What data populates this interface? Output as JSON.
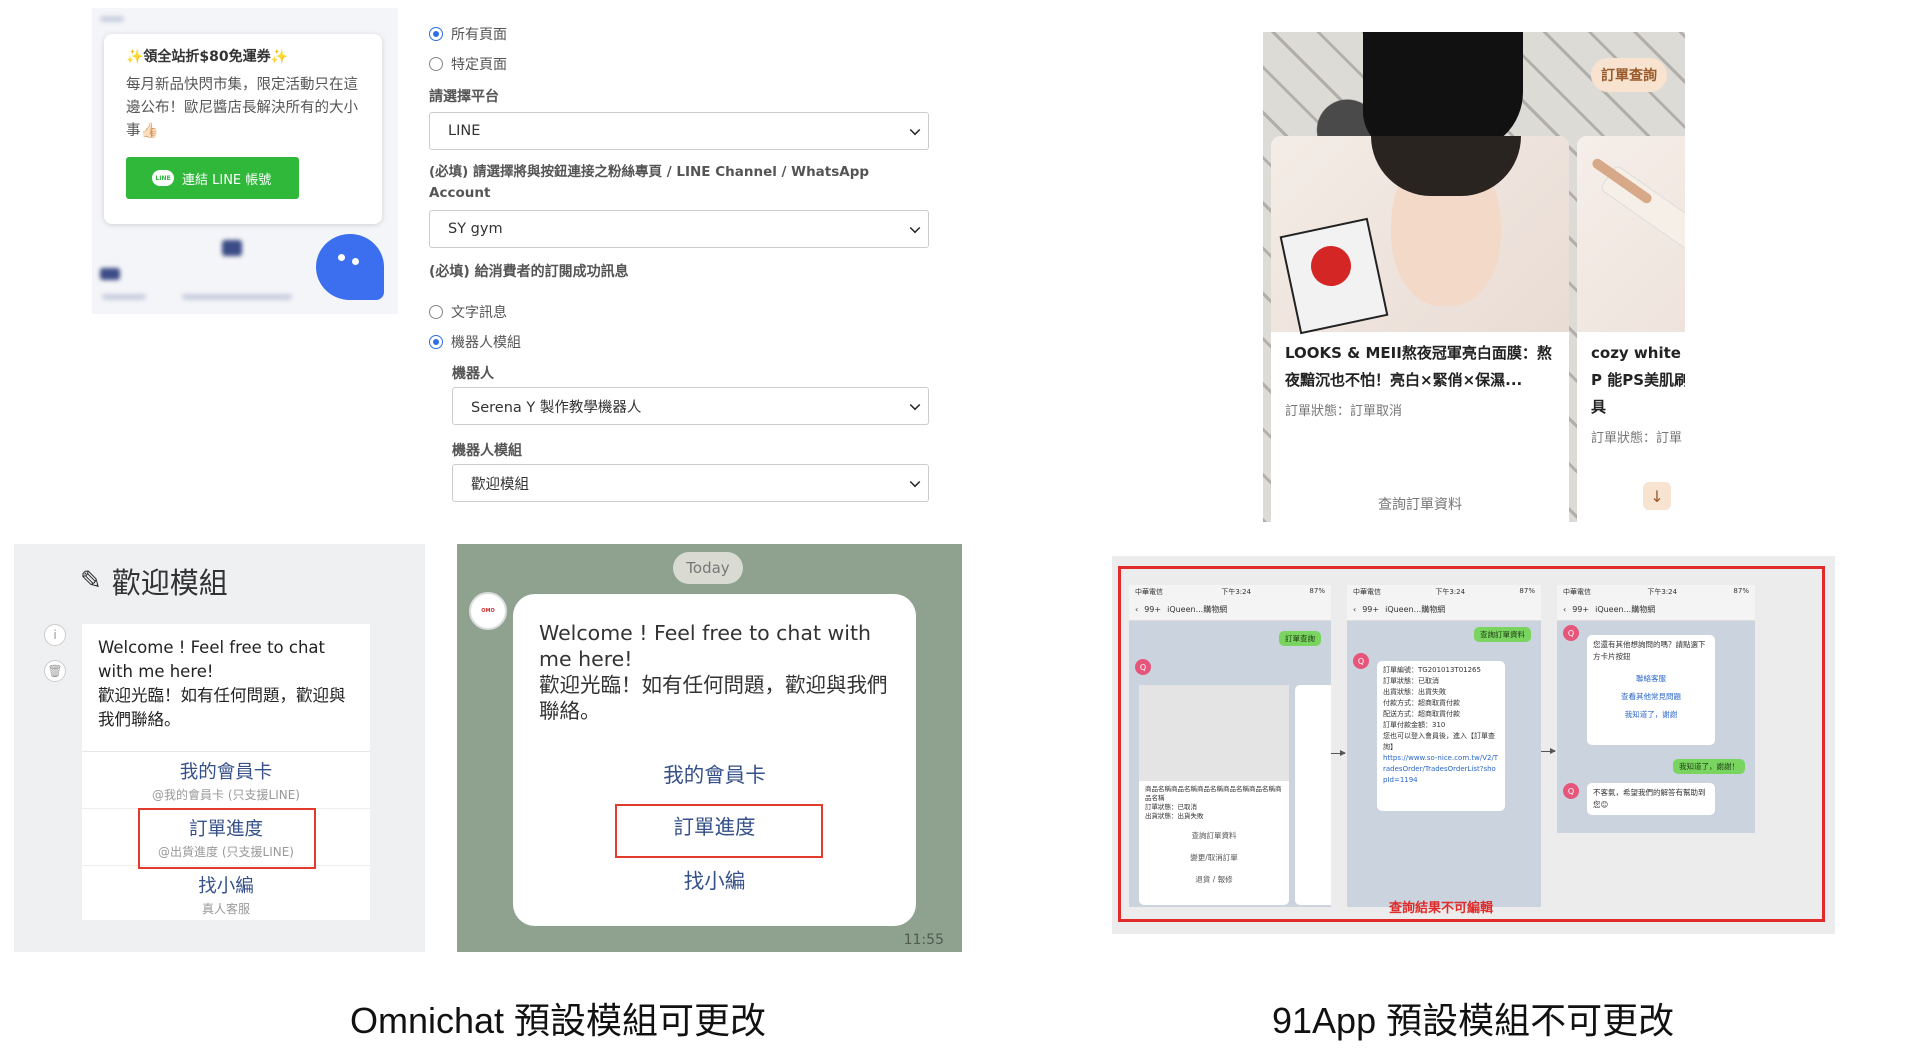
{
  "widget_preview": {
    "promo": "✨領全站折$80免運券✨",
    "description": "每月新品快閃市集，限定活動只在這邊公布！歐尼醬店長解決所有的大小事👍🏻",
    "line_button_icon": "LINE",
    "line_button": "連結 LINE 帳號"
  },
  "settings_form": {
    "radios_page": [
      {
        "label": "所有頁面",
        "selected": true
      },
      {
        "label": "特定頁面",
        "selected": false
      }
    ],
    "platform_label": "請選擇平台",
    "platform_value": "LINE",
    "channel_label": "(必填) 請選擇將與按鈕連接之粉絲專頁 / LINE Channel / WhatsApp Account",
    "channel_value": "SY gym",
    "success_label": "(必填) 給消費者的訂閱成功訊息",
    "radios_message": [
      {
        "label": "文字訊息",
        "selected": false
      },
      {
        "label": "機器人模組",
        "selected": true
      }
    ],
    "bot_label": "機器人",
    "bot_value": "Serena Y 製作教學機器人",
    "module_label": "機器人模組",
    "module_value": "歡迎模組"
  },
  "app91_cards": {
    "order_pill": "訂單查詢",
    "card1": {
      "title": "LOOKS & MEII熬夜冠軍亮白面膜：熬夜黯沉也不怕！亮白×緊俏×保濕...",
      "status": "訂單狀態：訂單取消",
      "query": "查詢訂單資料"
    },
    "card2": {
      "title": "cozy white P 能PS美肌刷具",
      "status": "訂單狀態：訂單"
    }
  },
  "editor": {
    "title": "歡迎模組",
    "message": "Welcome ! Feel free to chat with me here!\n歡迎光臨！如有任何問題，歡迎與我們聯絡。",
    "buttons": [
      {
        "label": "我的會員卡",
        "sub": "@我的會員卡 (只支援LINE)"
      },
      {
        "label": "訂單進度",
        "sub": "@出貨進度 (只支援LINE)"
      },
      {
        "label": "找小編",
        "sub": "真人客服"
      }
    ]
  },
  "chat": {
    "date_chip": "Today",
    "message": "Welcome ! Feel free to chat with me here!\n歡迎光臨！如有任何問題，歡迎與我們聯絡。",
    "buttons": [
      "我的會員卡",
      "訂單進度",
      "找小編"
    ],
    "time": "11:55"
  },
  "app91_screens": {
    "status_carrier": "中華電信",
    "status_time": "下午3:24",
    "status_battery": "87%",
    "back": "99+",
    "shop": "iQueen...購物網",
    "bubble_query": "訂單查詢",
    "bubble_query_data": "查詢訂單資料",
    "product_lines": "商品名稱商品名稱商品名稱商品名稱商品名稱商品名稱",
    "product_status": "訂單狀態：已取消",
    "product_status2": "出貨狀態：出貨失敗",
    "actions": [
      "查詢訂單資料",
      "變更/取消訂單",
      "退貨 / 報修"
    ],
    "order_detail": [
      "訂單編號：TG201013T01265",
      "訂單狀態：已取消",
      "出貨狀態：出貨失敗",
      "付款方式：超商取貨付款",
      "配送方式：超商取貨付款",
      "訂單付款金額：310",
      "您也可以登入會員後，進入【訂單查詢】"
    ],
    "order_link": "https://www.so-nice.com.tw/V2/TradesOrder/TradesOrderList?shopId=1194",
    "faq_question": "您還有其他想詢問的嗎？請點選下方卡片按鈕",
    "faq_options": [
      "聯絡客服",
      "查看其他常見問題",
      "我知道了，謝謝"
    ],
    "reply_thanks": "我知道了，謝謝！",
    "reply_bot": "不客氣，希望我們的解答有幫助到您😊",
    "note": "查詢結果不可編輯"
  },
  "captions": {
    "left": "Omnichat 預設模組可更改",
    "right": "91App 預設模組不可更改"
  }
}
